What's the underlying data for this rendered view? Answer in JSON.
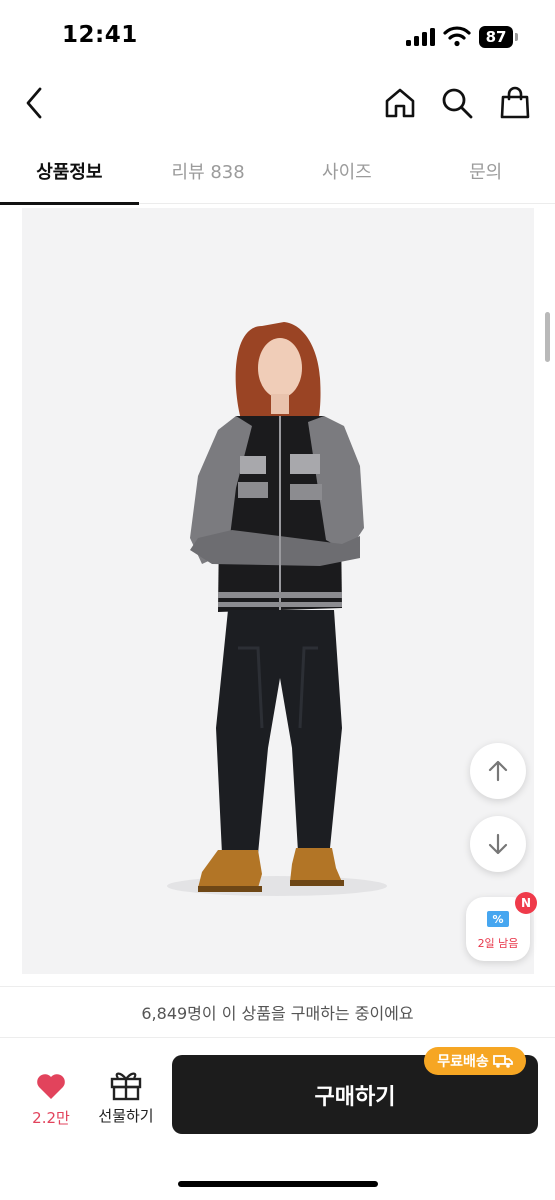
{
  "status_bar": {
    "time": "12:41",
    "battery": "87",
    "icons": [
      "signal-icon",
      "wifi-icon",
      "battery-icon"
    ]
  },
  "header": {
    "icons": [
      "chevron-left-icon",
      "home-icon",
      "search-icon",
      "shopping-bag-icon"
    ]
  },
  "tabs": [
    {
      "label": "상품정보",
      "active": true
    },
    {
      "label": "리뷰 838",
      "active": false
    },
    {
      "label": "사이즈",
      "active": false
    },
    {
      "label": "문의",
      "active": false
    }
  ],
  "floating": {
    "icons": [
      "arrow-up-icon",
      "arrow-down-icon",
      "coupon-icon"
    ],
    "coupon_label": "2일 남음",
    "coupon_badge": "N"
  },
  "purchase_notice": "6,849명이 이 상품을 구매하는 중이에요",
  "bottom_bar": {
    "like_count": "2.2만",
    "gift_label": "선물하기",
    "buy_label": "구매하기",
    "free_shipping_label": "무료배송",
    "icons": [
      "heart-icon",
      "gift-icon",
      "truck-icon"
    ]
  },
  "colors": {
    "accent_red": "#e2435c",
    "badge_red": "#ef3a4a",
    "buy_button": "#1c1c1c",
    "free_shipping": "#f6a623",
    "coupon_blue": "#46a6f0"
  }
}
